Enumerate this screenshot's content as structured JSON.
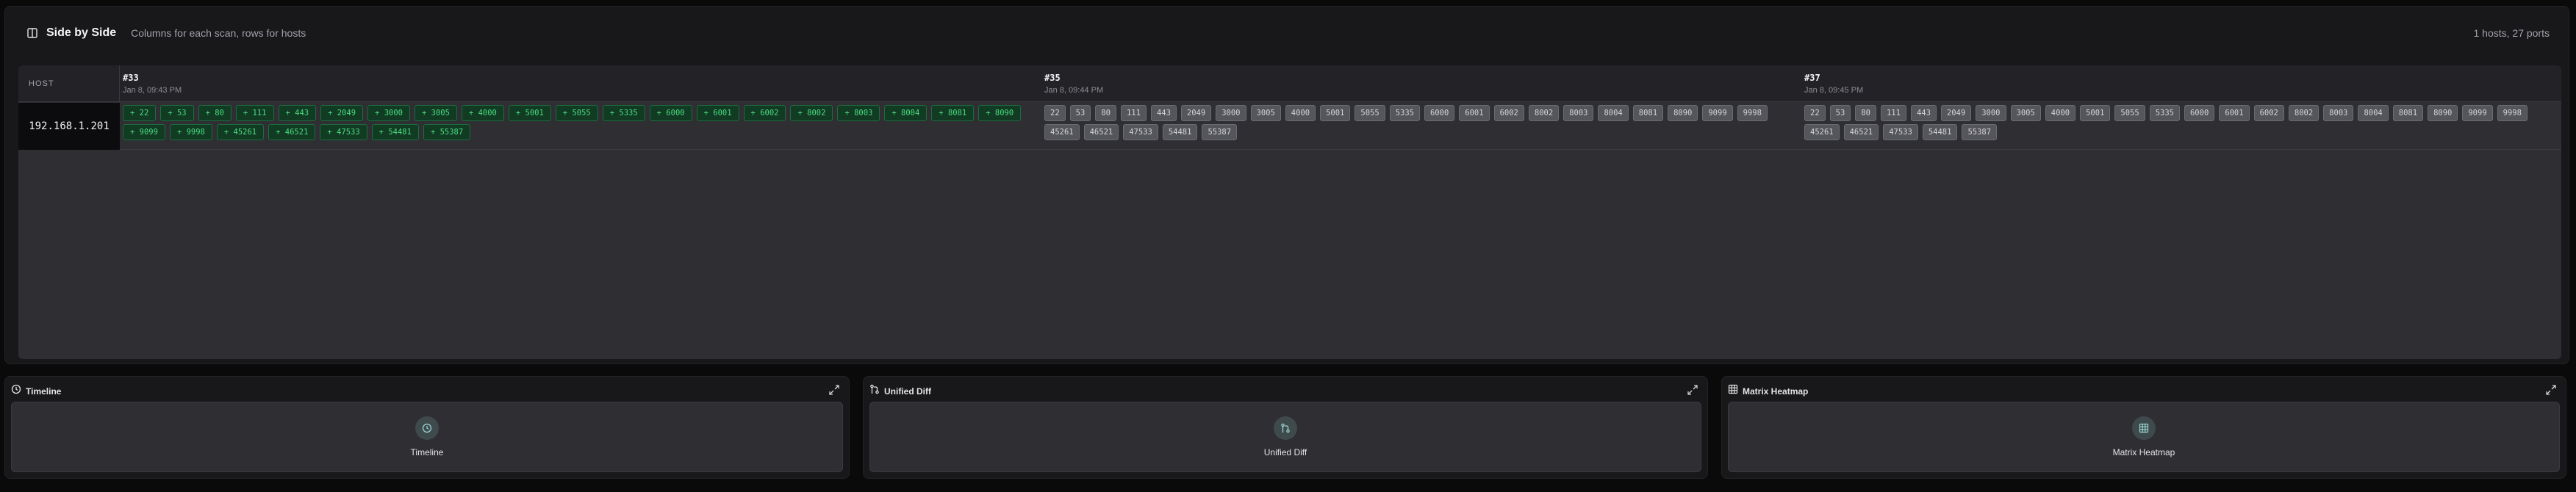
{
  "header": {
    "title": "Side by Side",
    "subtitle": "Columns for each scan, rows for hosts",
    "meta": "1 hosts, 27 ports"
  },
  "grid": {
    "host_header": "HOST",
    "scans": [
      {
        "id": "#33",
        "date": "Jan 8, 09:43 PM"
      },
      {
        "id": "#35",
        "date": "Jan 8, 09:44 PM"
      },
      {
        "id": "#37",
        "date": "Jan 8, 09:45 PM"
      }
    ],
    "rows": [
      {
        "host": "192.168.1.201",
        "cells": [
          [
            "+ 22",
            "+ 53",
            "+ 80",
            "+ 111",
            "+ 443",
            "+ 2049",
            "+ 3000",
            "+ 3005",
            "+ 4000",
            "+ 5001",
            "+ 5055",
            "+ 5335",
            "+ 6000",
            "+ 6001",
            "+ 6002",
            "+ 8002",
            "+ 8003",
            "+ 8004",
            "+ 8081",
            "+ 8090",
            "+ 9099",
            "+ 9998",
            "+ 45261",
            "+ 46521",
            "+ 47533",
            "+ 54481",
            "+ 55387"
          ],
          [
            "22",
            "53",
            "80",
            "111",
            "443",
            "2049",
            "3000",
            "3005",
            "4000",
            "5001",
            "5055",
            "5335",
            "6000",
            "6001",
            "6002",
            "8002",
            "8003",
            "8004",
            "8081",
            "8090",
            "9099",
            "9998",
            "45261",
            "46521",
            "47533",
            "54481",
            "55387"
          ],
          [
            "22",
            "53",
            "80",
            "111",
            "443",
            "2049",
            "3000",
            "3005",
            "4000",
            "5001",
            "5055",
            "5335",
            "6000",
            "6001",
            "6002",
            "8002",
            "8003",
            "8004",
            "8081",
            "8090",
            "9099",
            "9998",
            "45261",
            "46521",
            "47533",
            "54481",
            "55387"
          ]
        ]
      }
    ]
  },
  "cards": [
    {
      "title": "Timeline",
      "label": "Timeline",
      "icon": "clock-icon"
    },
    {
      "title": "Unified Diff",
      "label": "Unified Diff",
      "icon": "git-diff-icon"
    },
    {
      "title": "Matrix Heatmap",
      "label": "Matrix Heatmap",
      "icon": "grid-icon"
    }
  ],
  "colors": {
    "added_bg": "#123b24",
    "added_text": "#4ade80",
    "unchanged_bg": "#55555c",
    "panel_bg": "#18181b",
    "grid_bg": "#2e2e33"
  }
}
